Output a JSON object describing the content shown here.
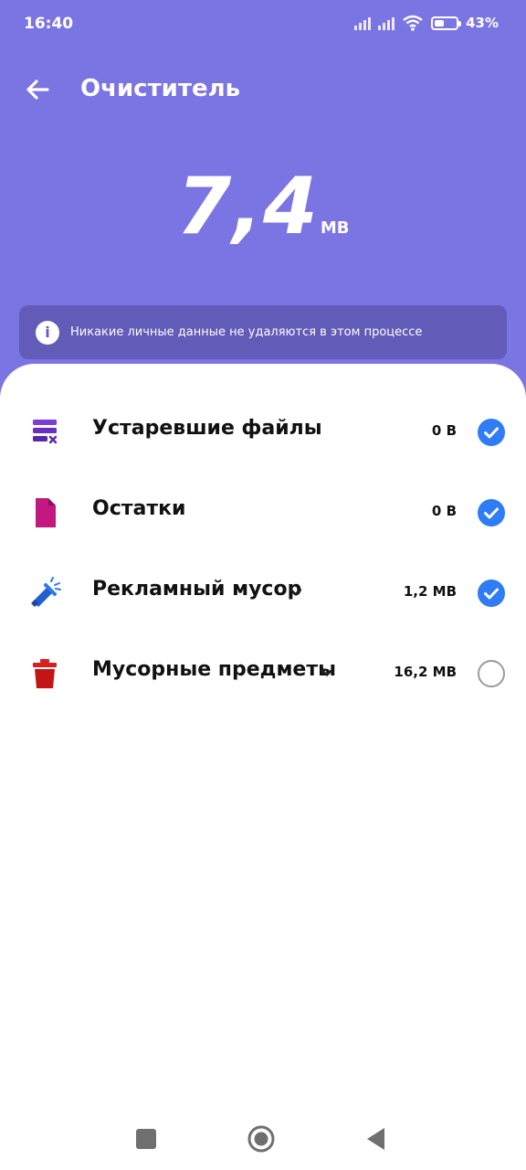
{
  "status": {
    "time": "16:40",
    "battery_pct": "43%",
    "battery_level": 0.43
  },
  "header": {
    "title": "Очиститель"
  },
  "summary": {
    "size_value": "7,4",
    "size_unit": "MB"
  },
  "notice": {
    "text": "Никакие личные данные не удаляются в этом процессе"
  },
  "items": [
    {
      "label": "Устаревшие файлы",
      "amount": "0 B",
      "checked": true,
      "expandable": false,
      "icon": "obsolete-files-icon"
    },
    {
      "label": "Остатки",
      "amount": "0 B",
      "checked": true,
      "expandable": false,
      "icon": "residual-file-icon"
    },
    {
      "label": "Рекламный мусор",
      "amount": "1,2 MB",
      "checked": true,
      "expandable": true,
      "icon": "megaphone-icon"
    },
    {
      "label": "Мусорные предметы",
      "amount": "16,2 MB",
      "checked": false,
      "expandable": true,
      "icon": "trash-bin-icon"
    }
  ],
  "colors": {
    "header_bg": "#7b74e3",
    "notice_bg": "#625bb7",
    "check": "#2e7cf6"
  }
}
